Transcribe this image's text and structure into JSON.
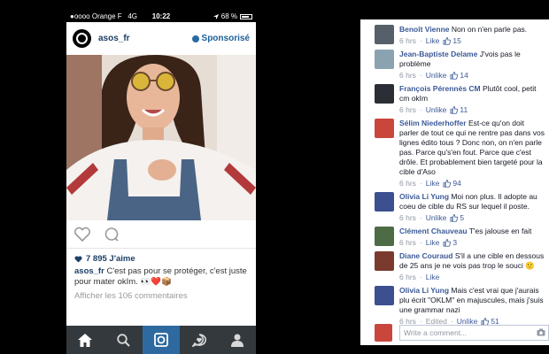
{
  "phone": {
    "status": {
      "carrier": "●oooo Orange F",
      "network": "4G",
      "time": "10:22",
      "battery": "68 %",
      "battery_level": 0.68
    },
    "post": {
      "username": "asos_fr",
      "sponsored_label": "Sponsorisé",
      "likes": "7 895 J'aime",
      "caption_user": "asos_fr",
      "caption_text": " C'est pas pour se protéger, c'est juste pour mater okIm. 👀❤️📦",
      "view_comments": "Afficher les 106 commentaires"
    },
    "tabs": [
      "home-icon",
      "search-icon",
      "camera-icon",
      "activity-icon",
      "profile-icon"
    ],
    "active_tab": 2
  },
  "fb": {
    "comments": [
      {
        "name": "Benoît Vienne",
        "text": " Non on n'en parle pas.",
        "time": "6 hrs",
        "action": "Like",
        "count": "15",
        "avatar_color": "#55606a",
        "edited": ""
      },
      {
        "name": "Jean-Baptiste Delame",
        "text": " J'vois pas le problème",
        "time": "6 hrs",
        "action": "Unlike",
        "count": "14",
        "avatar_color": "#8ba2b0",
        "edited": ""
      },
      {
        "name": "François Pérennès CM",
        "text": " Plutôt cool, petit cm okIm",
        "time": "6 hrs",
        "action": "Unlike",
        "count": "11",
        "avatar_color": "#2b2f35",
        "edited": ""
      },
      {
        "name": "Sélim Niederhoffer",
        "text": " Est-ce qu'on doit parler de tout ce qui ne rentre pas dans vos lignes édito tous ? Donc non, on n'en parle pas. Parce qu's'en fout. Parce que c'est drôle. Et probablement bien targeté pour la cible d'Aso",
        "time": "6 hrs",
        "action": "Like",
        "count": "94",
        "avatar_color": "#c9463d",
        "edited": ""
      },
      {
        "name": "Olivia Li Yung",
        "text": " Moi non plus. Il adopte au coeu de cible du RS sur lequel il poste.",
        "time": "6 hrs",
        "action": "Unlike",
        "count": "5",
        "avatar_color": "#3c4f8f",
        "edited": ""
      },
      {
        "name": "Clément Chauveau",
        "text": " T'es jalouse en fait",
        "time": "6 hrs",
        "action": "Like",
        "count": "3",
        "avatar_color": "#4d6b45",
        "edited": ""
      },
      {
        "name": "Diane Couraud",
        "text": " S'il a une cible en dessous de 25 ans je ne vois pas trop le souci 🙂",
        "time": "6 hrs",
        "action": "Like",
        "count": "",
        "avatar_color": "#7a3a2e",
        "edited": ""
      },
      {
        "name": "Olivia Li Yung",
        "text": " Mais c'est vrai que j'aurais plu écrit \"OKLM\" en majuscules, mais j'suis une grammar nazi",
        "time": "6 hrs",
        "action": "Unlike",
        "count": "51",
        "avatar_color": "#3c4f8f",
        "edited": "Edited"
      }
    ],
    "write_placeholder": "Write a comment..."
  }
}
